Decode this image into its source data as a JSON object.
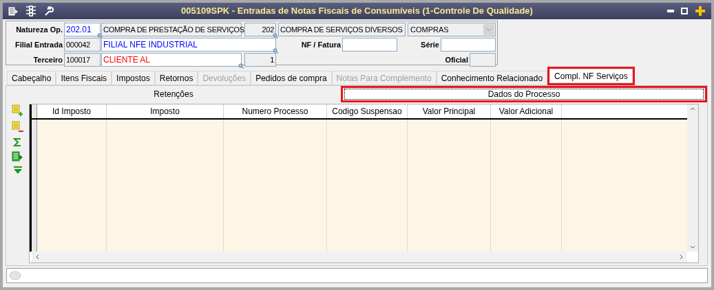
{
  "window": {
    "title": "005109SPK - Entradas de Notas Fiscais de Consumíveis (1-Controle De Qualidade)"
  },
  "form": {
    "rows": [
      {
        "label": "Natureza Op.",
        "fields": [
          {
            "value": "202.01",
            "readonly": false,
            "lookup": true,
            "color": "#0000ff",
            "kind": "text"
          },
          {
            "value": "COMPRA DE PRESTAÇÃO DE SERVIÇOS",
            "readonly": true,
            "lookup": false,
            "kind": "text"
          },
          {
            "value": "202",
            "readonly": true,
            "lookup": true,
            "kind": "number"
          },
          {
            "value": "COMPRA DE SERVIÇOS DIVERSOS",
            "readonly": true,
            "lookup": false,
            "kind": "text"
          }
        ],
        "dropdown": {
          "value": "COMPRAS",
          "disabled": true
        }
      },
      {
        "label": "Filial Entrada",
        "fields": [
          {
            "value": "000042",
            "readonly": true,
            "lookup": false,
            "kind": "text"
          },
          {
            "value": "FILIAL NFE INDUSTRIAL",
            "readonly": false,
            "lookup": true,
            "color": "#0000ff",
            "kind": "text"
          }
        ],
        "extra": [
          {
            "label": "NF / Fatura",
            "readonly": false
          },
          {
            "label": "Série",
            "readonly": false
          }
        ]
      },
      {
        "label": "Terceiro",
        "fields": [
          {
            "value": "100017",
            "readonly": true,
            "lookup": false,
            "kind": "text"
          },
          {
            "value": "CLIENTE AL",
            "readonly": false,
            "lookup": true,
            "color": "#ff0000",
            "kind": "text"
          },
          {
            "value": "1",
            "readonly": true,
            "lookup": false,
            "kind": "number"
          }
        ],
        "extra": [
          {
            "label": "Oficial",
            "readonly": true
          }
        ]
      }
    ]
  },
  "tabs": [
    {
      "label": "Cabeçalho",
      "selected": false,
      "disabled": false,
      "highlighted": false
    },
    {
      "label": "Itens Fiscais",
      "selected": false,
      "disabled": false,
      "highlighted": false
    },
    {
      "label": "Impostos",
      "selected": false,
      "disabled": false,
      "highlighted": false
    },
    {
      "label": "Retornos",
      "selected": false,
      "disabled": false,
      "highlighted": false
    },
    {
      "label": "Devoluções",
      "selected": false,
      "disabled": true,
      "highlighted": false
    },
    {
      "label": "Pedidos de compra",
      "selected": false,
      "disabled": false,
      "highlighted": false
    },
    {
      "label": "Notas Para Complemento",
      "selected": false,
      "disabled": true,
      "highlighted": false
    },
    {
      "label": "Conhecimento Relacionado",
      "selected": false,
      "disabled": false,
      "highlighted": false
    },
    {
      "label": "Compl. NF Serviços",
      "selected": true,
      "disabled": false,
      "highlighted": true
    }
  ],
  "subtabs": [
    {
      "label": "Retenções",
      "selected": false,
      "highlighted": false
    },
    {
      "label": "Dados do Processo",
      "selected": true,
      "highlighted": true
    }
  ],
  "table": {
    "columns": [
      "Id Imposto",
      "Imposto",
      "Numero Processo",
      "Codigo Suspensao",
      "Valor Principal",
      "Valor Adicional"
    ]
  }
}
